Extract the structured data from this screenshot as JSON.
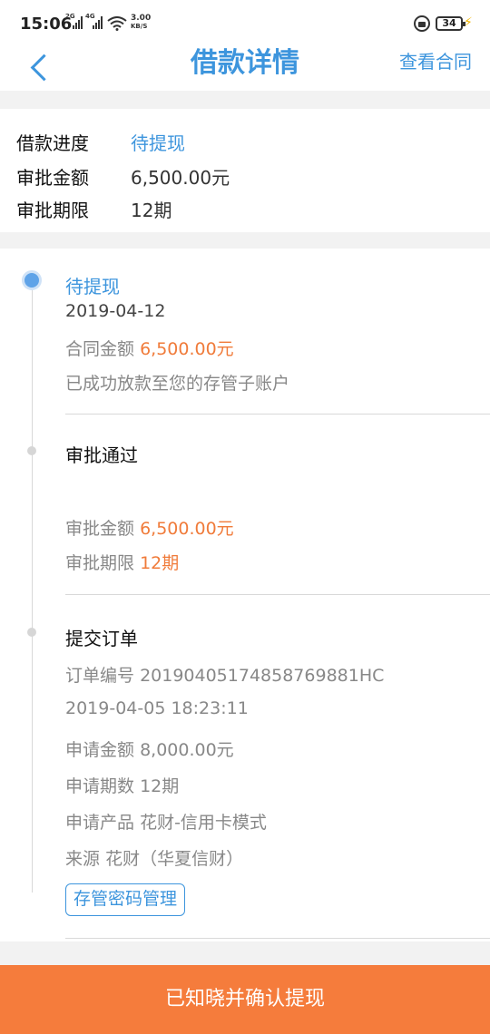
{
  "status_bar": {
    "time": "15:06",
    "signal1_tag": "2G",
    "signal2_tag": "4G",
    "speed_value": "3.00",
    "speed_unit": "KB/S",
    "battery": "34"
  },
  "header": {
    "title": "借款详情",
    "action_label": "查看合同"
  },
  "summary": {
    "progress_label": "借款进度",
    "progress_value": "待提现",
    "amount_label": "审批金额",
    "amount_value": "6,500.00元",
    "term_label": "审批期限",
    "term_value": "12期"
  },
  "timeline": {
    "step1": {
      "title": "待提现",
      "date": "2019-04-12",
      "contract_label": "合同金额",
      "contract_value": "6,500.00元",
      "note": "已成功放款至您的存管子账户"
    },
    "step2": {
      "title": "审批通过",
      "amount_label": "审批金额",
      "amount_value": "6,500.00元",
      "term_label": "审批期限",
      "term_value": "12期"
    },
    "step3": {
      "title": "提交订单",
      "order_label": "订单编号",
      "order_value": "20190405174858769881HC",
      "datetime": "2019-04-05 18:23:11",
      "apply_amount_label": "申请金额",
      "apply_amount_value": "8,000.00元",
      "apply_term_label": "申请期数",
      "apply_term_value": "12期",
      "product_label": "申请产品",
      "product_value": "花财-信用卡模式",
      "source_label": "来源",
      "source_value": "花财（华夏信财）"
    },
    "password_button_label": "存管密码管理"
  },
  "confirm_button_label": "已知晓并确认提现",
  "colors": {
    "accent_blue": "#3d95dd",
    "accent_orange": "#f07b3a",
    "button_orange": "#f57c3c"
  }
}
